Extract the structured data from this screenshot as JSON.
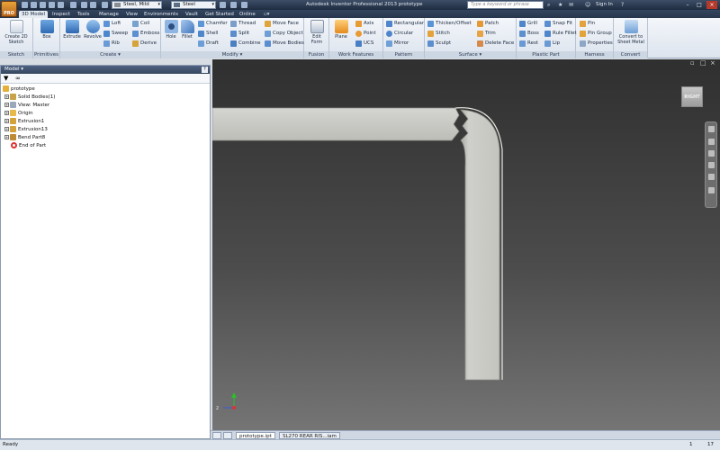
{
  "titlebar": {
    "app_button": "PRO",
    "material": "Steel, Mild",
    "appearance": "Steel",
    "title": "Autodesk Inventor Professional 2013   prototype",
    "search_placeholder": "Type a keyword or phrase",
    "sign_in": "Sign In"
  },
  "tabs": [
    "3D Model",
    "Inspect",
    "Tools",
    "Manage",
    "View",
    "Environments",
    "Vault",
    "Get Started",
    "Online"
  ],
  "ribbon": {
    "sketch": {
      "title": "Sketch",
      "create_sketch": "Create 2D Sketch"
    },
    "primitives": {
      "title": "Primitives",
      "box": "Box"
    },
    "create": {
      "title": "Create",
      "extrude": "Extrude",
      "revolve": "Revolve",
      "loft": "Loft",
      "sweep": "Sweep",
      "rib": "Rib",
      "coil": "Coil",
      "emboss": "Emboss",
      "derive": "Derive"
    },
    "modify": {
      "title": "Modify",
      "hole": "Hole",
      "fillet": "Fillet",
      "chamfer": "Chamfer",
      "shell": "Shell",
      "draft": "Draft",
      "thread": "Thread",
      "split": "Split",
      "combine": "Combine",
      "move_face": "Move Face",
      "copy_object": "Copy Object",
      "move_bodies": "Move Bodies"
    },
    "fusion": {
      "title": "Fusion",
      "edit_form": "Edit Form"
    },
    "work_features": {
      "title": "Work Features",
      "plane": "Plane",
      "axis": "Axis",
      "point": "Point",
      "ucs": "UCS"
    },
    "pattern": {
      "title": "Pattern",
      "rectangular": "Rectangular",
      "circular": "Circular",
      "mirror": "Mirror"
    },
    "surface": {
      "title": "Surface",
      "thicken_offset": "Thicken/Offset",
      "stitch": "Stitch",
      "sculpt": "Sculpt",
      "patch": "Patch",
      "trim": "Trim",
      "delete_face": "Delete Face"
    },
    "plastic_part": {
      "title": "Plastic Part",
      "grill": "Grill",
      "boss": "Boss",
      "rest": "Rest",
      "snap_fit": "Snap Fit",
      "rule_fillet": "Rule Fillet",
      "lip": "Lip"
    },
    "harness": {
      "title": "Harness",
      "pin": "Pin",
      "pin_group": "Pin Group",
      "properties": "Properties"
    },
    "convert": {
      "title": "Convert",
      "convert_sheet_metal": "Convert to Sheet Metal"
    }
  },
  "browser": {
    "title": "Model",
    "tree": [
      "prototype",
      "Solid Bodies(1)",
      "View: Master",
      "Origin",
      "Extrusion1",
      "Extrusion13",
      "Bend Part8",
      "End of Part"
    ]
  },
  "viewport": {
    "viewcube_label": "RIGHT"
  },
  "doc_tabs": [
    "prototype.ipt",
    "SL270 REAR RIS...iam"
  ],
  "status": {
    "text": "Ready",
    "count1": "1",
    "count2": "17"
  }
}
